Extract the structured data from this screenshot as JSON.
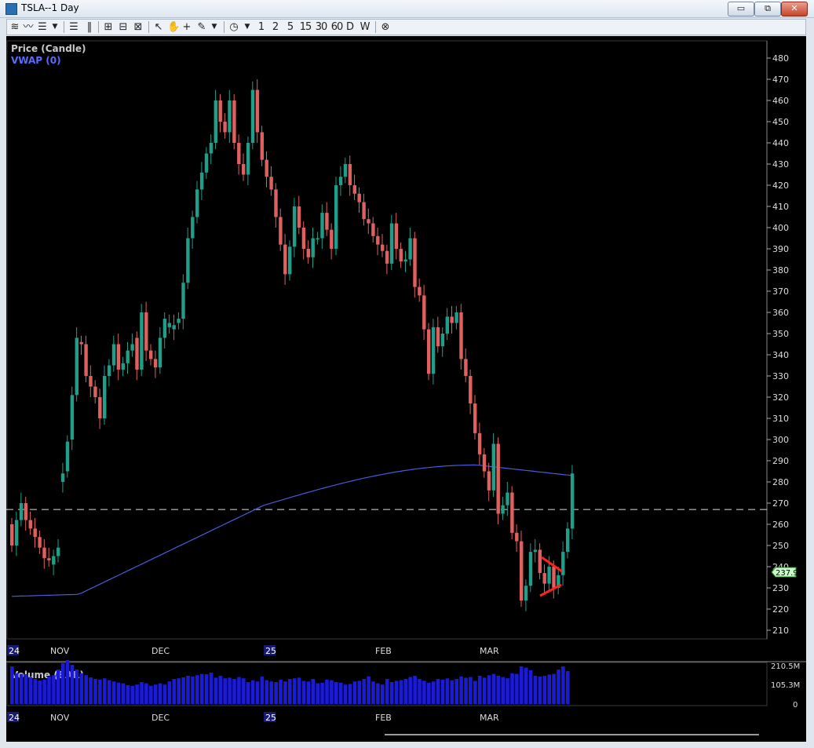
{
  "window": {
    "title": "TSLA--1 Day",
    "buttons": {
      "minimize": "▭",
      "restore": "⧉",
      "close": "✕"
    }
  },
  "toolbar": {
    "icons": [
      "chart-type-icon",
      "line-icon",
      "bars-icon",
      "dropdown-arrow-icon",
      "hlines-icon",
      "vlines-icon",
      "zoom-in-icon",
      "zoom-out-icon",
      "zoom-fit-icon",
      "pointer-icon",
      "hand-icon",
      "crosshair-icon",
      "pencil-icon",
      "dropdown-arrow-icon",
      "clock-icon",
      "dropdown-arrow-icon"
    ],
    "periods": [
      "1",
      "2",
      "5",
      "15",
      "30",
      "60",
      "D",
      "W"
    ],
    "close_icon": "circle-x-icon"
  },
  "price_panel": {
    "series_label": "Price (Candle)",
    "indicator_label": "VWAP (0)",
    "y_ticks": [
      "480",
      "470",
      "460",
      "450",
      "440",
      "430",
      "420",
      "410",
      "400",
      "390",
      "380",
      "370",
      "360",
      "350",
      "340",
      "330",
      "320",
      "310",
      "300",
      "290",
      "280",
      "270",
      "260",
      "250",
      "240",
      "230",
      "220",
      "210"
    ],
    "current_price": "237.9",
    "reference_line": 267,
    "x_labels": [
      "24",
      "NOV",
      "DEC",
      "25",
      "FEB",
      "MAR"
    ]
  },
  "volume_panel": {
    "label": "Volume (BAR)",
    "y_ticks": [
      "210.5M",
      "105.3M",
      "0"
    ],
    "x_labels": [
      "24",
      "NOV",
      "DEC",
      "25",
      "FEB",
      "MAR"
    ]
  },
  "colors": {
    "up": "#1f9e8a",
    "down": "#e06060",
    "vwap": "#4a5ad8",
    "volume": "#1a1ad8",
    "axis": "#ffffff",
    "trend": "#ff2020"
  },
  "chart_data": {
    "type": "candlestick",
    "symbol": "TSLA",
    "interval": "1 Day",
    "ylim": [
      210,
      485
    ],
    "candles": [
      [
        260,
        250
      ],
      [
        250,
        262
      ],
      [
        262,
        270
      ],
      [
        270,
        262
      ],
      [
        262,
        258
      ],
      [
        258,
        254
      ],
      [
        254,
        249
      ],
      [
        249,
        244
      ],
      [
        244,
        243
      ],
      [
        241,
        245
      ],
      [
        245,
        249
      ],
      [
        280,
        284
      ],
      [
        285,
        299
      ],
      [
        300,
        321
      ],
      [
        321,
        348
      ],
      [
        346,
        345
      ],
      [
        345,
        330
      ],
      [
        330,
        325
      ],
      [
        325,
        320
      ],
      [
        320,
        310
      ],
      [
        310,
        330
      ],
      [
        330,
        335
      ],
      [
        335,
        345
      ],
      [
        345,
        333
      ],
      [
        333,
        336
      ],
      [
        336,
        342
      ],
      [
        342,
        345
      ],
      [
        348,
        333
      ],
      [
        333,
        360
      ],
      [
        360,
        342
      ],
      [
        342,
        338
      ],
      [
        338,
        334
      ],
      [
        334,
        348
      ],
      [
        348,
        357
      ],
      [
        353,
        355
      ],
      [
        352,
        354
      ],
      [
        355,
        357
      ],
      [
        357,
        374
      ],
      [
        374,
        395
      ],
      [
        395,
        405
      ],
      [
        405,
        418
      ],
      [
        418,
        426
      ],
      [
        426,
        435
      ],
      [
        435,
        440
      ],
      [
        440,
        460
      ],
      [
        460,
        450
      ],
      [
        450,
        445
      ],
      [
        445,
        460
      ],
      [
        460,
        440
      ],
      [
        440,
        430
      ],
      [
        430,
        425
      ],
      [
        425,
        440
      ],
      [
        440,
        465
      ],
      [
        465,
        445
      ],
      [
        445,
        432
      ],
      [
        432,
        424
      ],
      [
        424,
        418
      ],
      [
        418,
        405
      ],
      [
        405,
        392
      ],
      [
        392,
        378
      ],
      [
        378,
        391
      ],
      [
        391,
        410
      ],
      [
        410,
        400
      ],
      [
        400,
        390
      ],
      [
        390,
        386
      ],
      [
        386,
        395
      ],
      [
        395,
        395
      ],
      [
        395,
        407
      ],
      [
        407,
        399
      ],
      [
        399,
        390
      ],
      [
        390,
        420
      ],
      [
        420,
        424
      ],
      [
        424,
        430
      ],
      [
        430,
        420
      ],
      [
        420,
        416
      ],
      [
        416,
        412
      ],
      [
        412,
        404
      ],
      [
        404,
        402
      ],
      [
        402,
        396
      ],
      [
        396,
        392
      ],
      [
        392,
        389
      ],
      [
        389,
        383
      ],
      [
        383,
        402
      ],
      [
        402,
        390
      ],
      [
        390,
        384
      ],
      [
        384,
        385
      ],
      [
        385,
        395
      ],
      [
        395,
        372
      ],
      [
        372,
        368
      ],
      [
        368,
        352
      ],
      [
        352,
        331
      ],
      [
        331,
        353
      ],
      [
        353,
        344
      ],
      [
        344,
        350
      ],
      [
        350,
        358
      ],
      [
        358,
        355
      ],
      [
        355,
        360
      ],
      [
        360,
        338
      ],
      [
        338,
        330
      ],
      [
        330,
        317
      ],
      [
        317,
        303
      ],
      [
        303,
        293
      ],
      [
        293,
        285
      ],
      [
        285,
        276
      ],
      [
        276,
        298
      ],
      [
        298,
        265
      ],
      [
        265,
        269
      ],
      [
        269,
        275
      ],
      [
        275,
        256
      ],
      [
        256,
        252
      ],
      [
        252,
        224
      ],
      [
        224,
        231
      ],
      [
        231,
        247
      ],
      [
        247,
        248
      ],
      [
        248,
        237
      ],
      [
        237,
        232
      ],
      [
        232,
        240
      ],
      [
        240,
        230
      ],
      [
        230,
        236
      ],
      [
        236,
        247
      ],
      [
        247,
        258
      ],
      [
        258,
        284
      ]
    ],
    "volume": [
      120,
      98,
      96,
      95,
      86,
      80,
      75,
      78,
      88,
      92,
      110,
      130,
      140,
      125,
      110,
      98,
      92,
      85,
      80,
      78,
      82,
      76,
      72,
      68,
      66,
      60,
      58,
      62,
      70,
      66,
      58,
      62,
      66,
      62,
      72,
      80,
      82,
      85,
      90,
      88,
      92,
      96,
      95,
      100,
      84,
      90,
      82,
      84,
      80,
      86,
      82,
      70,
      76,
      72,
      88,
      76,
      72,
      70,
      78,
      72,
      80,
      82,
      84,
      74,
      72,
      80,
      66,
      68,
      78,
      76,
      70,
      68,
      62,
      64,
      72,
      74,
      80,
      88,
      72,
      66,
      62,
      80,
      70,
      74,
      76,
      80,
      86,
      90,
      80,
      74,
      68,
      72,
      80,
      78,
      82,
      76,
      80,
      88,
      84,
      86,
      74,
      90,
      84,
      92,
      96,
      90,
      86,
      82,
      98,
      96,
      120,
      116,
      108,
      90,
      88,
      90,
      94,
      96,
      110,
      120,
      105
    ],
    "volume_max": "210.5M",
    "vwap": "rising from ~226 to ~288 then easing to ~283"
  }
}
